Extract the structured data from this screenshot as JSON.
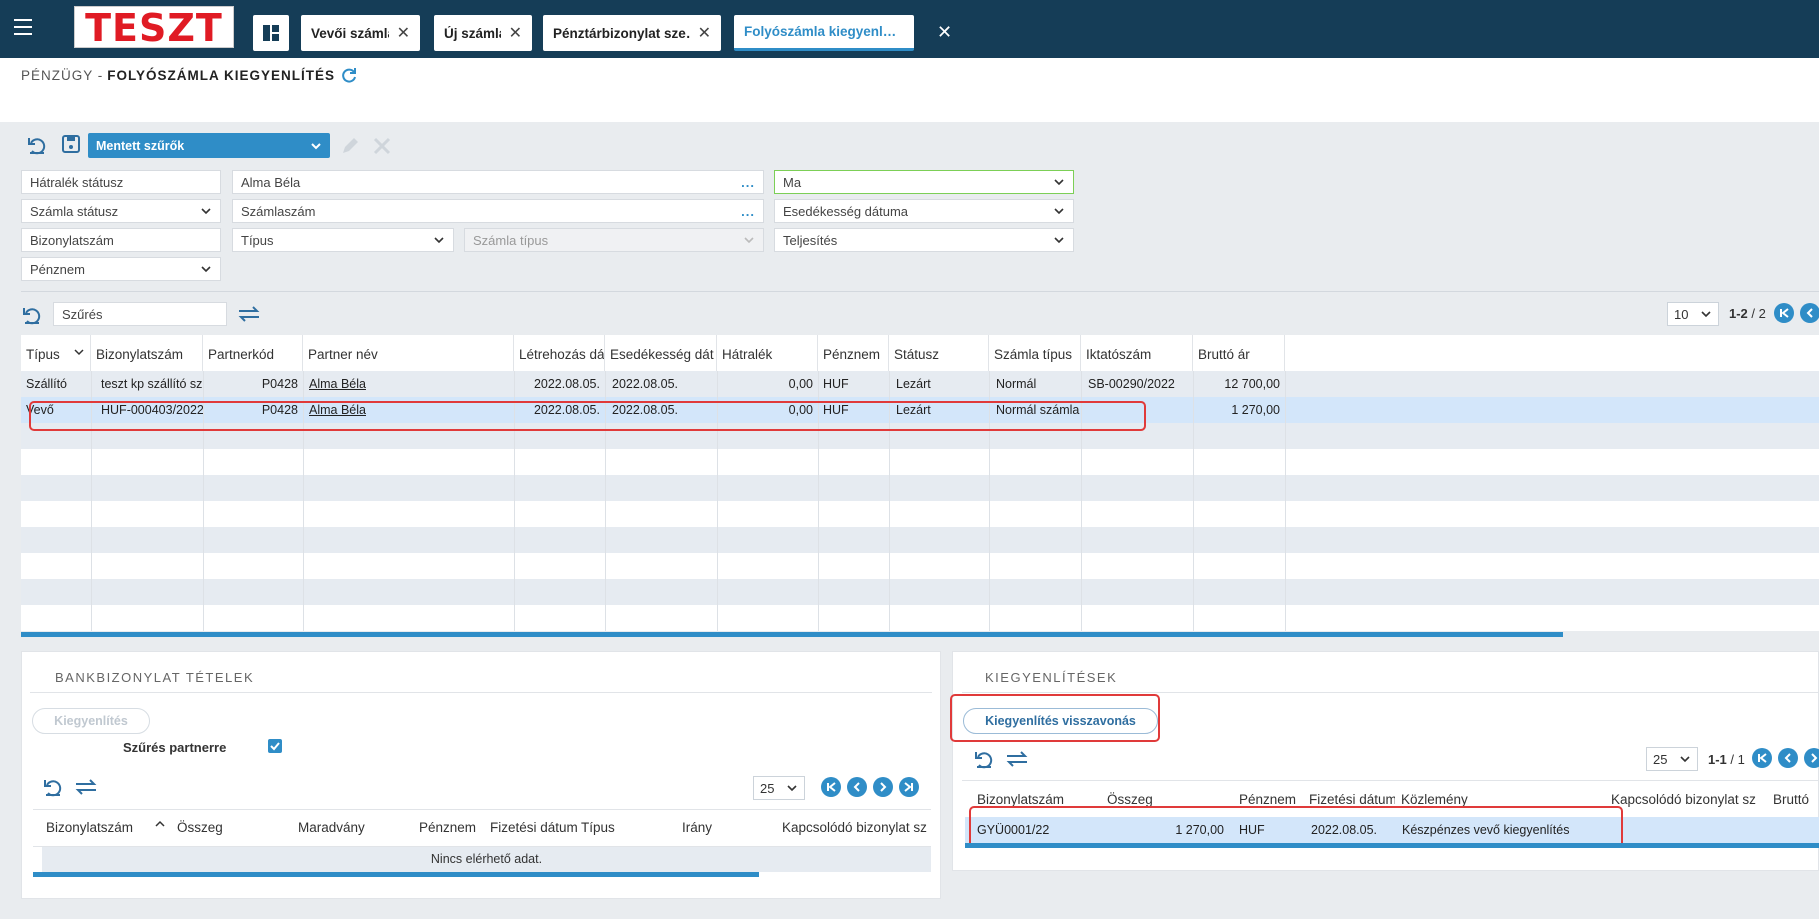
{
  "header": {
    "logo": "TESZT",
    "tabs": [
      {
        "label": "Vevői számla"
      },
      {
        "label": "Új számla"
      },
      {
        "label": "Pénztárbizonylat sze…"
      },
      {
        "label": "Folyószámla kiegyenl…",
        "active": true
      }
    ],
    "colors": {
      "bar": "#153d57",
      "accent": "#2f8dc7",
      "highlight": "#e03a3a"
    }
  },
  "breadcrumb": {
    "section": "PÉNZÜGY -",
    "page": "FOLYÓSZÁMLA KIEGYENLÍTÉS"
  },
  "filters": {
    "saved_filters": "Mentett szűrők",
    "hatralek_status": "Hátralék státusz",
    "partner": "Alma Béla",
    "date_preset": "Ma",
    "szamla_status": "Számla státusz",
    "szamlaszam": "Számlaszám",
    "esedekesseg": "Esedékesség dátuma",
    "bizonylatszam": "Bizonylatszám",
    "tipus": "Típus",
    "szamla_tipus": "Számla típus",
    "teljesites": "Teljesítés",
    "penznem": "Pénznem"
  },
  "main_grid": {
    "search_placeholder": "Szűrés",
    "page_size": "10",
    "range": "1-2",
    "total": "/ 2",
    "columns": [
      "Típus",
      "Bizonylatszám",
      "Partnerkód",
      "Partner név",
      "Létrehozás dát",
      "Esedékesség dát",
      "Hátralék",
      "Pénznem",
      "Státusz",
      "Számla típus",
      "Iktatószám",
      "Bruttó ár"
    ],
    "rows": [
      {
        "tipus": "Szállító",
        "bizonylatszam": "teszt kp szállító szla",
        "partnerkod": "P0428",
        "partner": "Alma Béla",
        "letrehozas": "2022.08.05.",
        "esedekesseg": "2022.08.05.",
        "hatralek": "0,00",
        "penznem": "HUF",
        "statusz": "Lezárt",
        "szamla_tipus": "Normál",
        "iktatoszam": "SB-00290/2022",
        "brutto": "12 700,00"
      },
      {
        "tipus": "Vevő",
        "bizonylatszam": "HUF-000403/2022",
        "partnerkod": "P0428",
        "partner": "Alma Béla",
        "letrehozas": "2022.08.05.",
        "esedekesseg": "2022.08.05.",
        "hatralek": "0,00",
        "penznem": "HUF",
        "statusz": "Lezárt",
        "szamla_tipus": "Normál számla",
        "iktatoszam": "",
        "brutto": "1 270,00"
      }
    ]
  },
  "bank_panel": {
    "title": "BANKBIZONYLAT TÉTELEK",
    "settle_button": "Kiegyenlítés",
    "filter_partner": "Szűrés partnerre",
    "filter_partner_checked": true,
    "page_size": "25",
    "columns": [
      "Bizonylatszám",
      "Összeg",
      "Maradvány",
      "Pénznem",
      "Fizetési dátum",
      "Típus",
      "Irány",
      "Kapcsolódó bizonylat sz"
    ],
    "empty": "Nincs elérhető adat."
  },
  "settle_panel": {
    "title": "KIEGYENLÍTÉSEK",
    "revoke_button": "Kiegyenlítés visszavonás",
    "page_size": "25",
    "range": "1-1",
    "total": "/ 1",
    "columns": [
      "Bizonylatszám",
      "Összeg",
      "Pénznem",
      "Fizetési dátum",
      "Közlemény",
      "Kapcsolódó bizonylat sz",
      "Bruttó"
    ],
    "rows": [
      {
        "bizonylatszam": "GYÜ0001/22",
        "osszeg": "1 270,00",
        "penznem": "HUF",
        "datum": "2022.08.05.",
        "kozlemeny": "Készpénzes vevő kiegyenlítés",
        "kapcsolodo": "",
        "brutto": ""
      }
    ]
  }
}
